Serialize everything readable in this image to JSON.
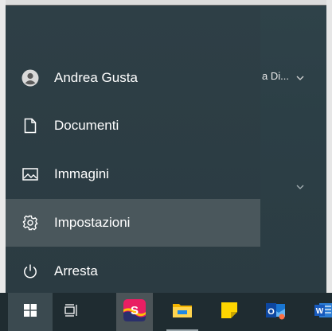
{
  "start_menu": {
    "nav_items": [
      {
        "label": "Andrea Gusta",
        "icon": "user-avatar-icon"
      },
      {
        "label": "Documenti",
        "icon": "document-icon"
      },
      {
        "label": "Immagini",
        "icon": "pictures-icon"
      },
      {
        "label": "Impostazioni",
        "icon": "gear-icon",
        "highlighted": true
      },
      {
        "label": "Arresta",
        "icon": "power-icon"
      }
    ],
    "tile_group_text": "a Di...",
    "accent_hover": "#4a575c"
  },
  "taskbar": {
    "items": [
      {
        "name": "start-button",
        "icon": "windows-logo-icon"
      },
      {
        "name": "task-view-button",
        "icon": "task-view-icon"
      },
      {
        "name": "slack-app",
        "icon": "slack-icon",
        "letter": "S"
      },
      {
        "name": "file-explorer-app",
        "icon": "folder-icon"
      },
      {
        "name": "sticky-notes-app",
        "icon": "sticky-notes-icon"
      },
      {
        "name": "outlook-app",
        "icon": "outlook-icon",
        "letter": "O"
      },
      {
        "name": "word-app",
        "icon": "word-icon",
        "letter": "W"
      }
    ],
    "background": "#1f2c31"
  }
}
